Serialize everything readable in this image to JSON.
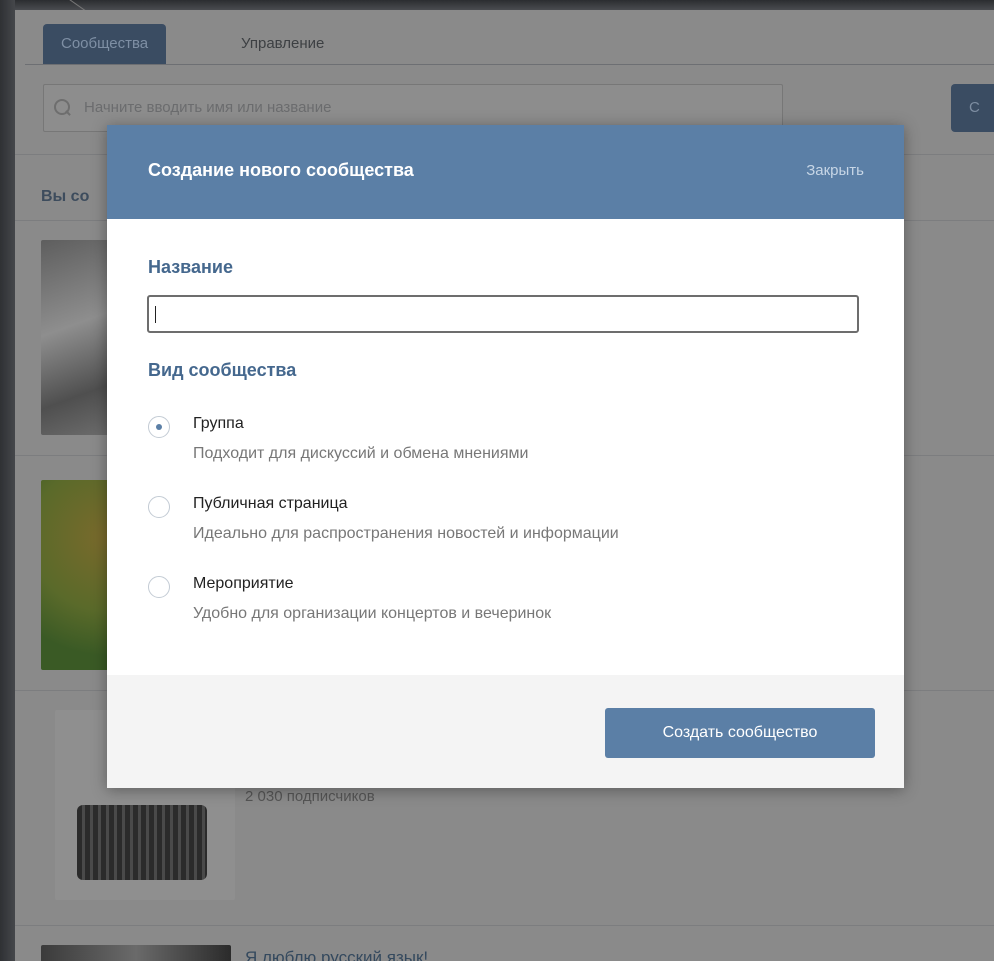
{
  "background": {
    "tabs": [
      {
        "label": "Сообщества"
      },
      {
        "label": "Управление"
      }
    ],
    "search": {
      "placeholder": "Начните вводить имя или название"
    },
    "create_button_partial": "С",
    "section_label_partial": "Вы со",
    "subscribers_text": "2 030 подписчиков",
    "group_title_partial": "Я люблю русский язык!"
  },
  "modal": {
    "title": "Создание нового сообщества",
    "close_label": "Закрыть",
    "name_label": "Название",
    "name_value": "",
    "type_label": "Вид сообщества",
    "options": [
      {
        "title": "Группа",
        "description": "Подходит для дискуссий и обмена мнениями",
        "selected": true
      },
      {
        "title": "Публичная страница",
        "description": "Идеально для распространения новостей и информации",
        "selected": false
      },
      {
        "title": "Мероприятие",
        "description": "Удобно для организации концертов и вечеринок",
        "selected": false
      }
    ],
    "submit_label": "Создать сообщество"
  },
  "colors": {
    "accent": "#5b7fa6",
    "label": "#45688e"
  },
  "icons": [
    "search-icon",
    "radio-selected-icon"
  ]
}
